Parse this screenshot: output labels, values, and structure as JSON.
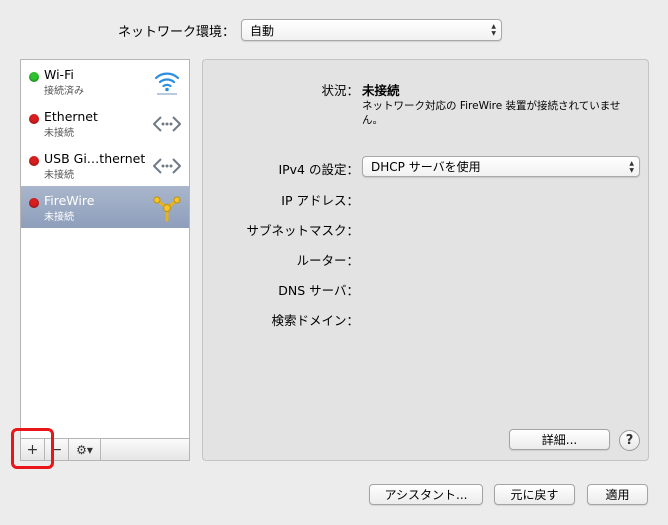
{
  "location": {
    "label": "ネットワーク環境：",
    "selected": "自動"
  },
  "services": [
    {
      "name": "Wi-Fi",
      "status": "接続済み",
      "indicator": "green",
      "icon": "wifi-icon"
    },
    {
      "name": "Ethernet",
      "status": "未接続",
      "indicator": "red",
      "icon": "ethernet-icon"
    },
    {
      "name": "USB Gi…thernet",
      "status": "未接続",
      "indicator": "red",
      "icon": "ethernet-icon"
    },
    {
      "name": "FireWire",
      "status": "未接続",
      "indicator": "red",
      "icon": "firewire-icon"
    }
  ],
  "toolbar": {
    "add": "+",
    "remove": "−",
    "gear": "⚙▾"
  },
  "detail": {
    "status_label": "状況：",
    "status_value": "未接続",
    "status_desc": "ネットワーク対応の FireWire 装置が接続されていません。",
    "ipv4_label": "IPv4 の設定：",
    "ipv4_value": "DHCP サーバを使用",
    "ip_label": "IP アドレス：",
    "subnet_label": "サブネットマスク：",
    "router_label": "ルーター：",
    "dns_label": "DNS サーバ：",
    "search_label": "検索ドメイン：",
    "advanced_button": "詳細...",
    "help": "?"
  },
  "footer": {
    "assistant": "アシスタント...",
    "revert": "元に戻す",
    "apply": "適用"
  },
  "colors": {
    "green": "#2fc12f",
    "red": "#d81e1e",
    "selected": "#9aa9c3",
    "highlight": "#e8161b"
  }
}
